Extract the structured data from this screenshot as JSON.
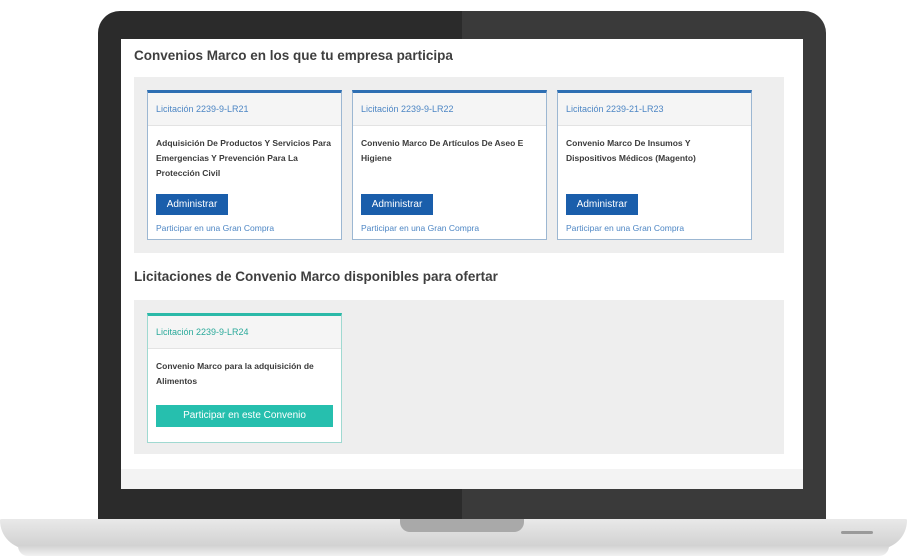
{
  "section_participating": {
    "title": "Convenios Marco en los que tu empresa participa",
    "cards": [
      {
        "code": "Licitación 2239-9-LR21",
        "description": "Adquisición De Productos Y Servicios Para Emergencias Y Prevención Para La Protección Civil",
        "admin_label": "Administrar",
        "link_label": "Participar en una Gran Compra"
      },
      {
        "code": "Licitación 2239-9-LR22",
        "description": "Convenio Marco De Artículos De Aseo E Higiene",
        "admin_label": "Administrar",
        "link_label": "Participar en una Gran Compra"
      },
      {
        "code": "Licitación 2239-21-LR23",
        "description": "Convenio Marco De Insumos Y Dispositivos Médicos (Magento)",
        "admin_label": "Administrar",
        "link_label": "Participar en una Gran Compra"
      }
    ]
  },
  "section_available": {
    "title": "Licitaciones de Convenio Marco disponibles para ofertar",
    "cards": [
      {
        "code": "Licitación 2239-9-LR24",
        "description": "Convenio Marco para la adquisición de Alimentos",
        "button_label": "Participar en este Convenio"
      }
    ]
  },
  "colors": {
    "admin_button": "#1a5eab",
    "participate_button": "#26bfae",
    "card_border_blue": "#2e6fb3",
    "card_border_teal": "#2bb9a8",
    "link": "#4d86c4"
  }
}
